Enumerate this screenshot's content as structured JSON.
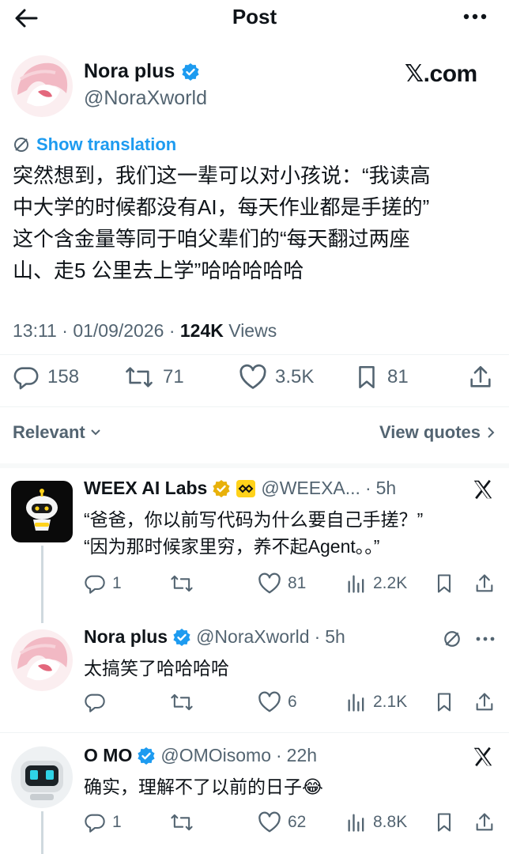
{
  "header": {
    "title": "Post"
  },
  "main_post": {
    "author_name": "Nora plus",
    "handle": "@NoraXworld",
    "watermark": "𝕏.com",
    "show_translation": "Show translation",
    "text_lines": [
      "突然想到，我们这一辈可以对小孩说：“我读高",
      "中大学的时候都没有AI，每天作业都是手搓的”",
      "这个含金量等同于咱父辈们的“每天翻过两座",
      "山、走5 公里去上学”哈哈哈哈哈"
    ],
    "time": "13:11",
    "date": "01/09/2026",
    "views_count": "124K",
    "views_label": "Views",
    "stats": {
      "replies": "158",
      "reposts": "71",
      "likes": "3.5K",
      "bookmarks": "81"
    }
  },
  "sort": {
    "relevant": "Relevant",
    "view_quotes": "View quotes"
  },
  "replies": [
    {
      "name": "WEEX AI Labs",
      "handle": "@WEEXA...",
      "time": "5h",
      "text_lines": [
        "“爸爸，你以前写代码为什么要自己手搓？”",
        "“因为那时候家里穷，养不起Agent。。”"
      ],
      "replies": "1",
      "reposts": "",
      "likes": "81",
      "views": "2.2K"
    },
    {
      "name": "Nora plus",
      "handle": "@NoraXworld",
      "time": "5h",
      "text_lines": [
        "太搞笑了哈哈哈哈"
      ],
      "replies": "",
      "reposts": "",
      "likes": "6",
      "views": "2.1K"
    },
    {
      "name": "O MO",
      "handle": "@OMOisomo",
      "time": "22h",
      "text_lines": [
        "确实，理解不了以前的日子😂"
      ],
      "replies": "1",
      "reposts": "",
      "likes": "62",
      "views": "8.8K"
    }
  ],
  "colors": {
    "accent": "#1d9bf0",
    "verified": "#1d9bf0",
    "gold": "#e8b10a",
    "text": "#0f1419",
    "muted": "#536471"
  }
}
